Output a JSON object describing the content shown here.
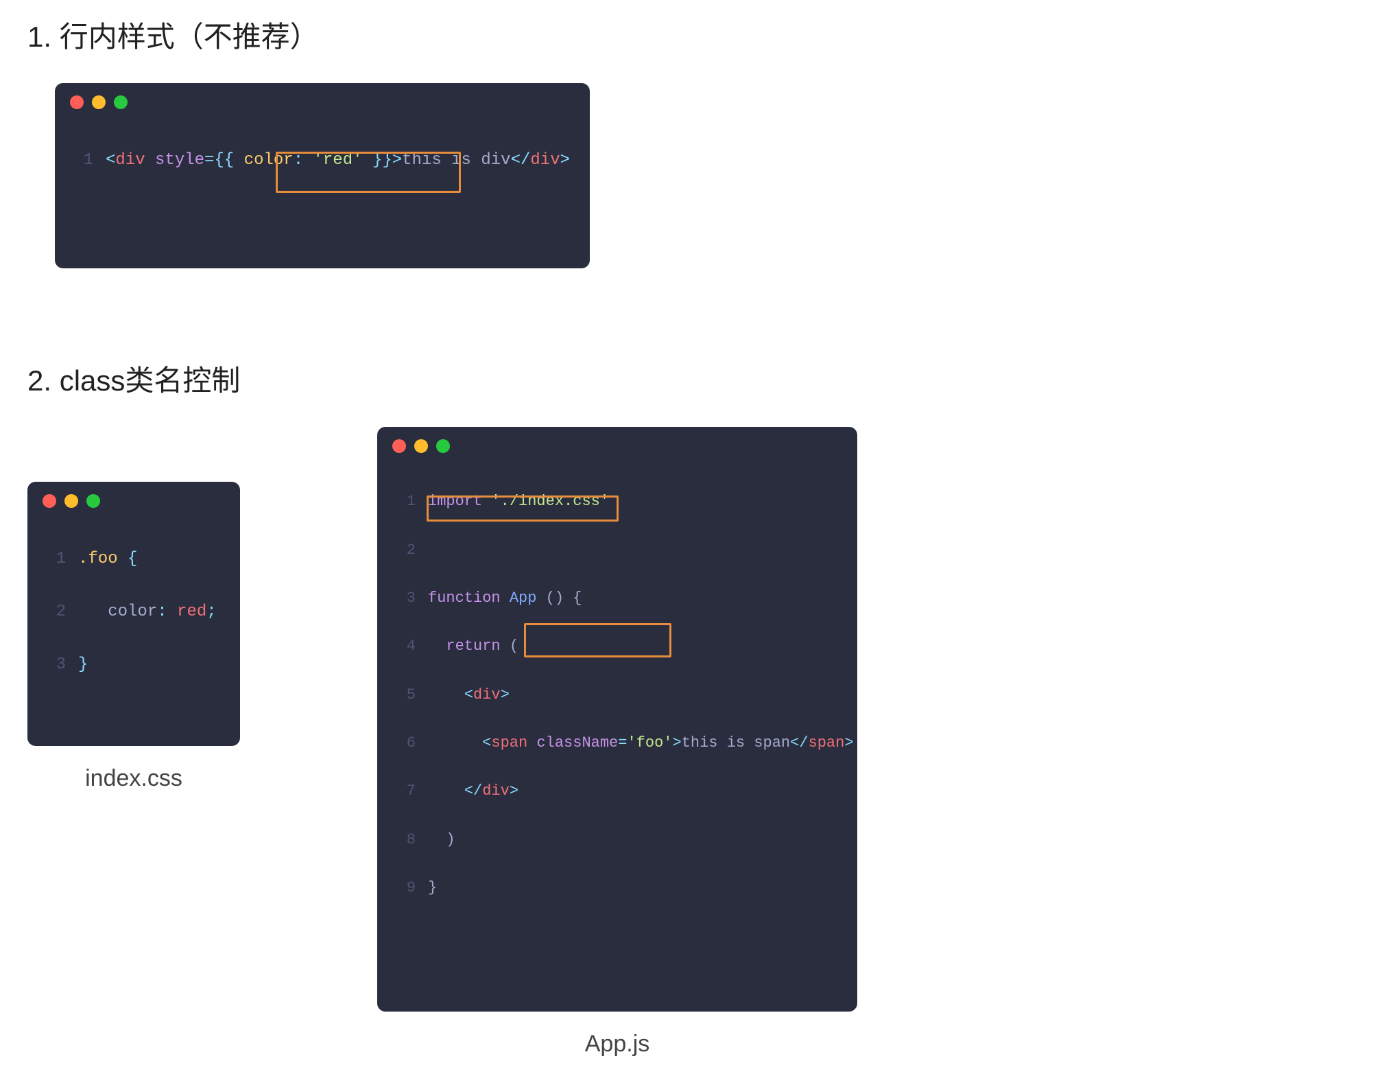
{
  "section1": {
    "heading": "1. 行内样式（不推荐）",
    "code": {
      "line": "1",
      "tokens": {
        "lt1": "<",
        "tag_open": "div",
        "sp1": " ",
        "attr": "style",
        "eq": "=",
        "lb1": "{",
        "lb2": "{ ",
        "prop": "color",
        "colon": ": ",
        "val": "'red'",
        "rb1": " }",
        "rb2": "}",
        "gt1": ">",
        "text": "this is div",
        "lt2": "</",
        "tag_close": "div",
        "gt2": ">"
      }
    }
  },
  "section2": {
    "heading": "2. class类名控制",
    "css_file": {
      "caption": "index.css",
      "lines": {
        "l1_num": "1",
        "l1_sel": ".foo",
        "l1_brace": " {",
        "l2_num": "2",
        "l2_indent": "   ",
        "l2_prop": "color",
        "l2_colon": ": ",
        "l2_val": "red",
        "l2_semi": ";",
        "l3_num": "3",
        "l3_brace": "}"
      }
    },
    "app_file": {
      "caption": "App.js",
      "lines": {
        "l1_num": "1",
        "l1_import": "import",
        "l1_sp": " ",
        "l1_str": "'./index.css'",
        "l2_num": "2",
        "l3_num": "3",
        "l3_fn": "function",
        "l3_sp": " ",
        "l3_name": "App",
        "l3_after": " () {",
        "l4_num": "4",
        "l4_indent": "  ",
        "l4_ret": "return",
        "l4_paren": " (",
        "l5_num": "5",
        "l5_indent": "    ",
        "l5_lt": "<",
        "l5_tag": "div",
        "l5_gt": ">",
        "l6_num": "6",
        "l6_indent": "      ",
        "l6_lt": "<",
        "l6_tag": "span",
        "l6_sp": " ",
        "l6_attr": "className",
        "l6_eq": "=",
        "l6_val": "'foo'",
        "l6_gt": ">",
        "l6_text": "this is span",
        "l6_lt2": "</",
        "l6_tag2": "span",
        "l6_gt2": ">",
        "l7_num": "7",
        "l7_indent": "    ",
        "l7_lt": "</",
        "l7_tag": "div",
        "l7_gt": ">",
        "l8_num": "8",
        "l8_indent": "  ",
        "l8_paren": ")",
        "l9_num": "9",
        "l9_brace": "}"
      }
    }
  }
}
